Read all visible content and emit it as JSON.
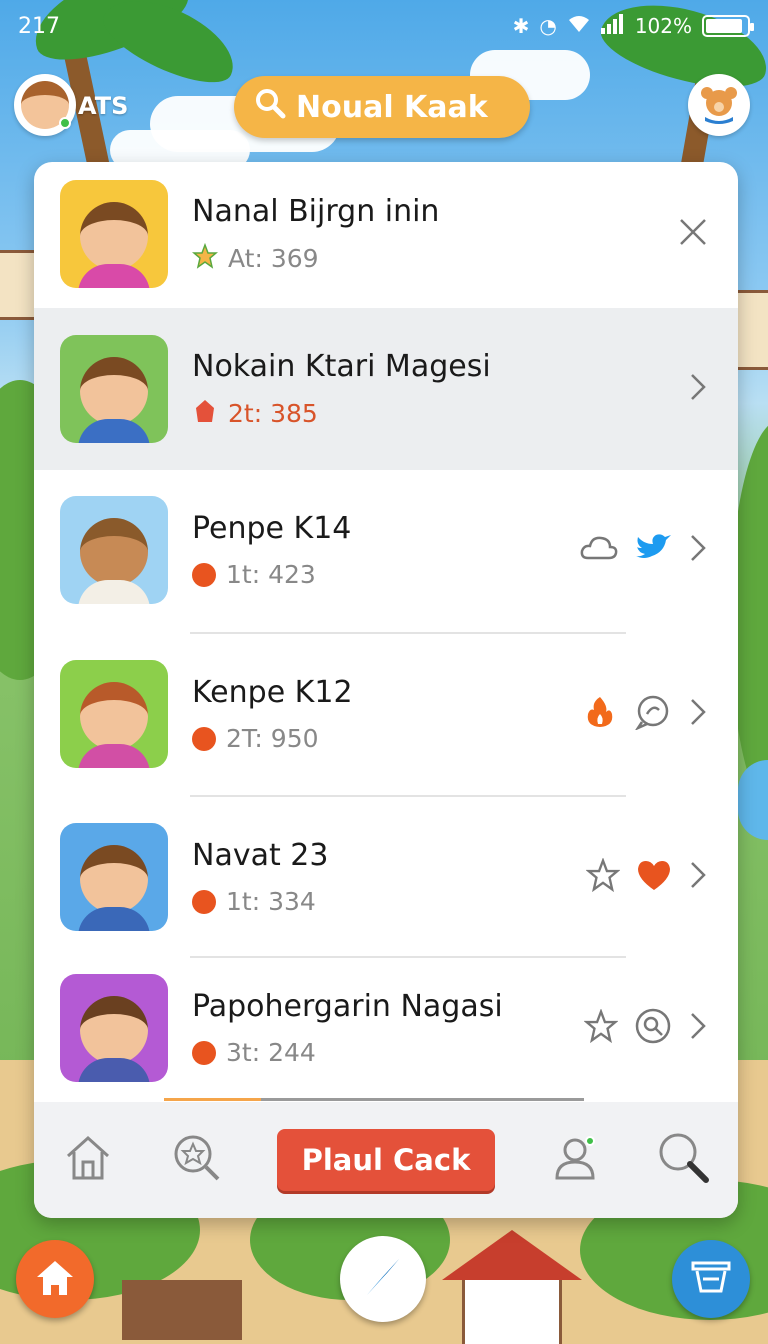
{
  "status_bar": {
    "time": "217",
    "battery": "102%",
    "battery_level": 0.9
  },
  "header": {
    "user_tag": "ATS",
    "search_label": "Noual Kaak"
  },
  "items": [
    {
      "title": "Nanal Bijrgn inin",
      "sub": "At: 369",
      "sub_icon": "star-icon",
      "actions": [
        "close-icon"
      ],
      "thumb_bg": "#f7c73c",
      "body_color": "#d94aa8"
    },
    {
      "title": "Nokain Ktari Magesi",
      "sub": "2t: 385",
      "sub_icon": "gem-icon",
      "actions": [
        "chevron-right-icon"
      ],
      "thumb_bg": "#7fc35a",
      "body_color": "#3b6fc4"
    },
    {
      "title": "Penpe K14",
      "sub": "1t: 423",
      "sub_icon": "coin-icon",
      "actions": [
        "cloud-icon",
        "bird-icon",
        "chevron-right-icon"
      ],
      "thumb_bg": "#9fd3f3",
      "body_color": "#f3efe6"
    },
    {
      "title": "Kenpe K12",
      "sub": "2T: 950",
      "sub_icon": "coin-icon",
      "actions": [
        "fire-icon",
        "chat-icon",
        "chevron-right-icon"
      ],
      "thumb_bg": "#8ccf4b",
      "body_color": "#d24fa5"
    },
    {
      "title": "Navat 23",
      "sub": "1t: 334",
      "sub_icon": "coin-icon",
      "actions": [
        "star-outline-icon",
        "heart-icon",
        "chevron-right-icon"
      ],
      "thumb_bg": "#5aa8e8",
      "body_color": "#3a68b8"
    },
    {
      "title": "Papohergarin Nagasi",
      "sub": "3t: 244",
      "sub_icon": "coin-icon",
      "actions": [
        "star-outline-icon",
        "search-circle-icon",
        "chevron-right-icon"
      ],
      "thumb_bg": "#b45ad4",
      "body_color": "#4a5cae"
    }
  ],
  "bottom_bar": {
    "cta_label": "Plaul Cack",
    "scroll_progress": 0.23
  },
  "colors": {
    "accent": "#f5b547",
    "cta": "#e4513a",
    "coin": "#e8541f",
    "twitter": "#1d9bf0",
    "fab_home": "#f26a2b",
    "fab_basket": "#2d8fd8"
  }
}
